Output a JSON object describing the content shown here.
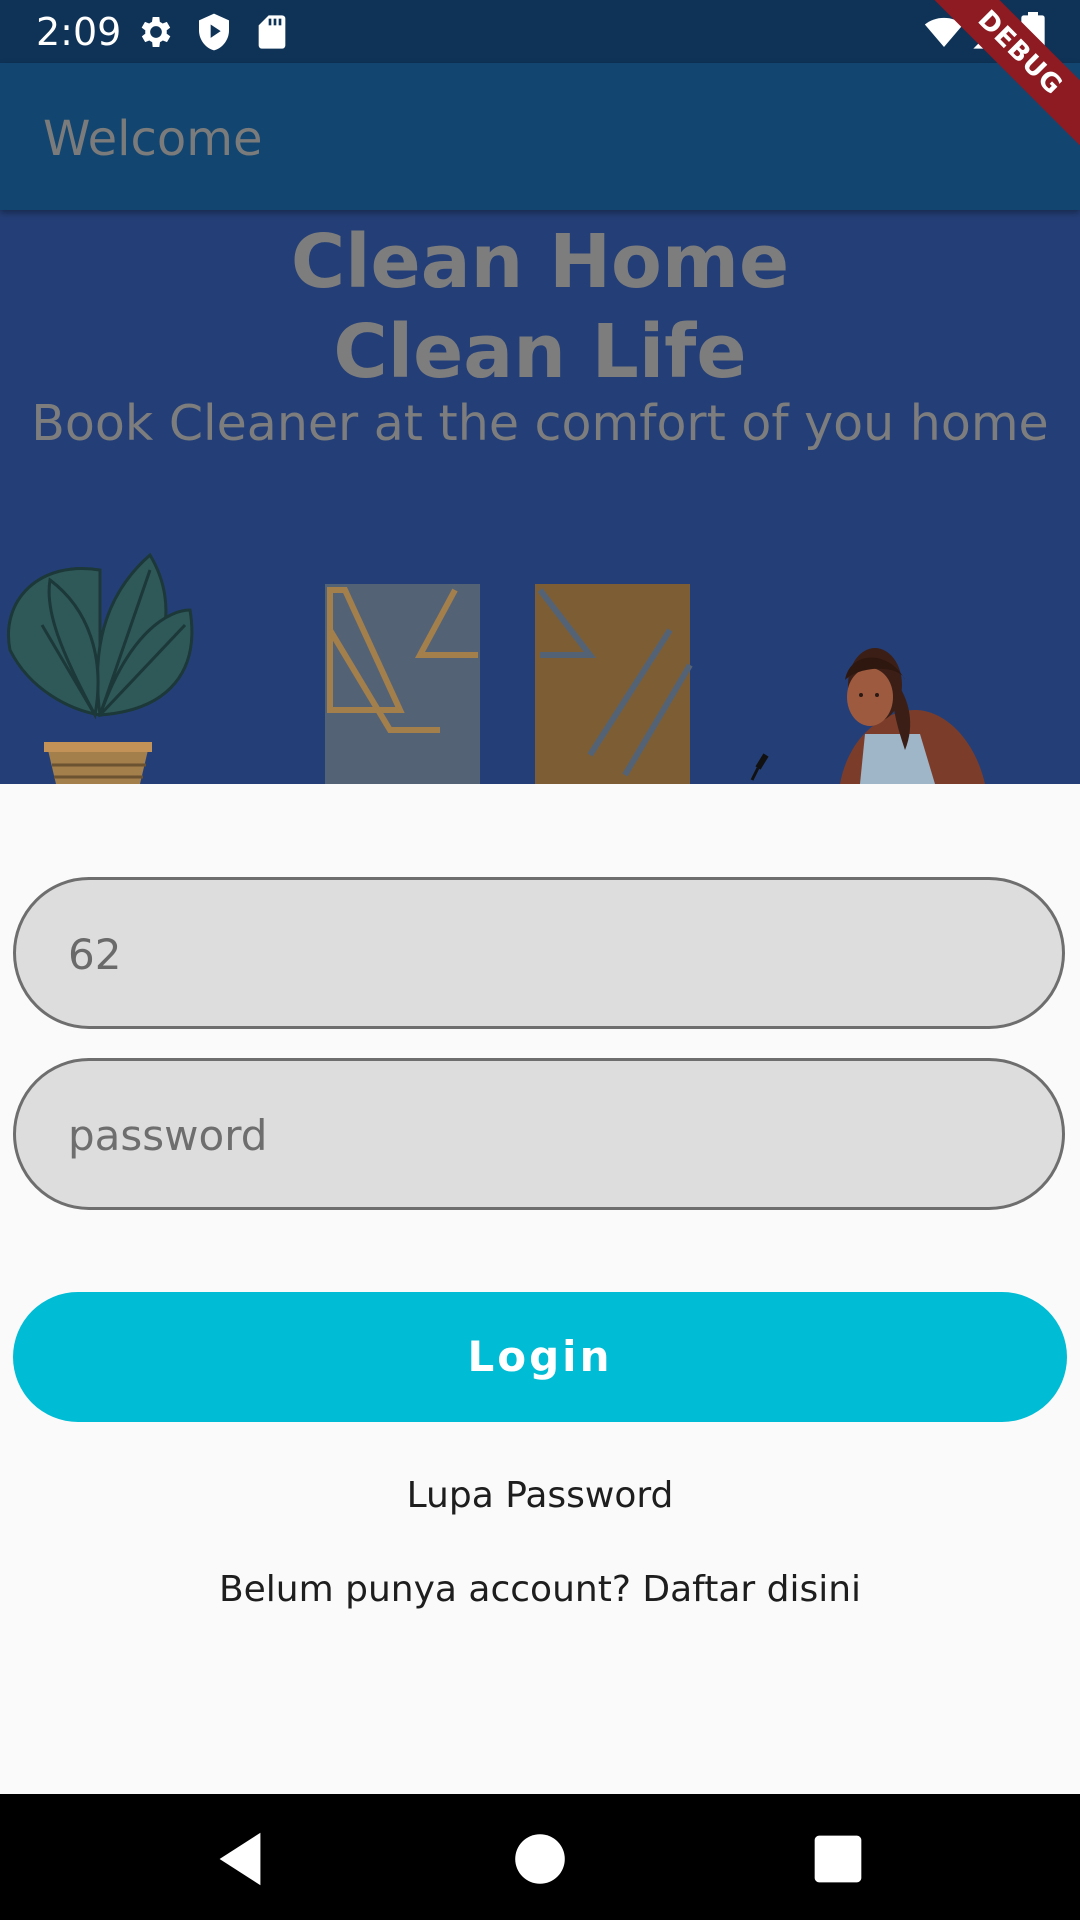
{
  "status_bar": {
    "time": "2:09",
    "icons": [
      "settings-icon",
      "shield-play-icon",
      "sd-card-icon",
      "wifi-icon",
      "signal-icon",
      "battery-icon"
    ]
  },
  "app_bar": {
    "title": "Welcome"
  },
  "debug_banner": "DEBUG",
  "hero": {
    "title_line1": "Clean Home",
    "title_line2": "Clean Life",
    "subtitle": "Book Cleaner at the comfort of you home"
  },
  "form": {
    "phone_value": "62",
    "password_placeholder": "password",
    "login_label": "Login",
    "forgot_password": "Lupa Password",
    "register_prompt": "Belum punya account? Daftar disini"
  },
  "nav_bar": {
    "icons": [
      "back-icon",
      "home-icon",
      "recents-icon"
    ]
  },
  "colors": {
    "status_bar": "#0e3357",
    "app_bar": "#124670",
    "hero_bg": "#243f77",
    "accent": "#00bcd4",
    "input_bg": "#dddddd"
  }
}
